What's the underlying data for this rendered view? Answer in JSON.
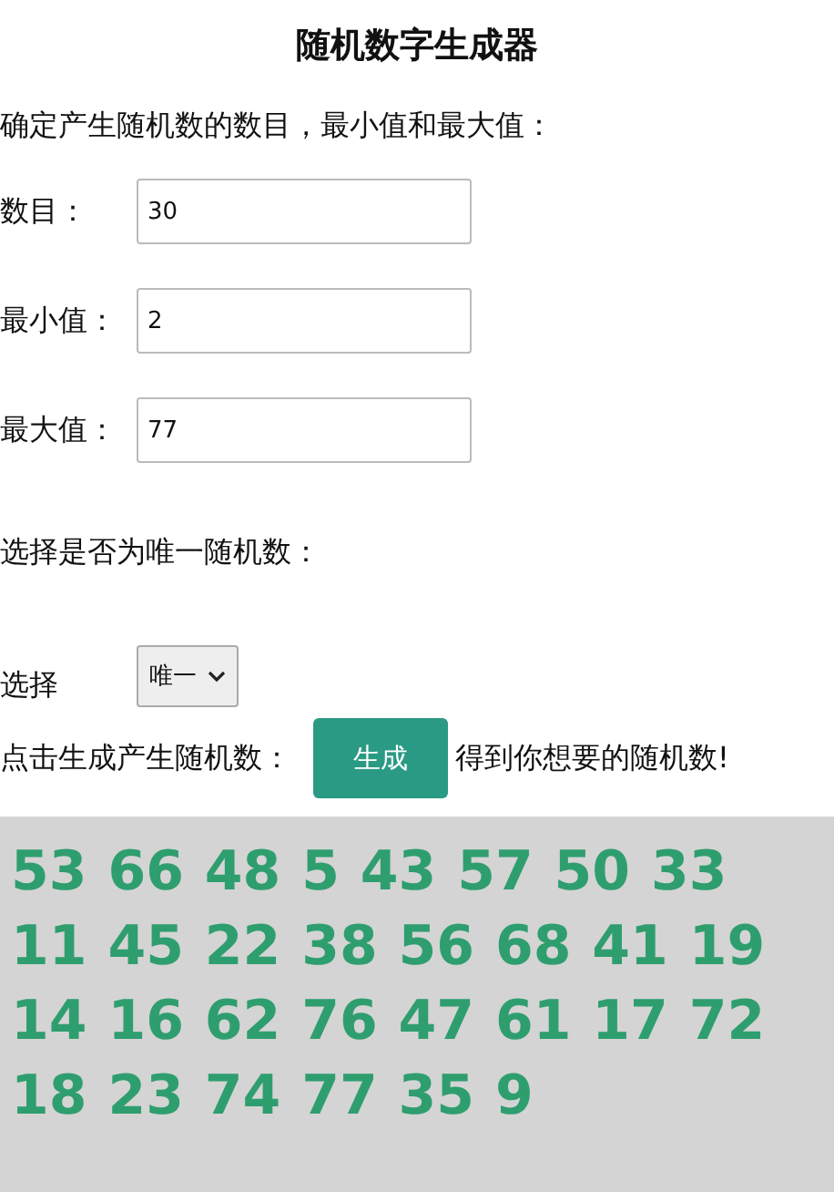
{
  "title": "随机数字生成器",
  "intro": "确定产生随机数的数目，最小值和最大值：",
  "fields": [
    {
      "label": "数目：",
      "value": "30"
    },
    {
      "label": "最小值：",
      "value": "2"
    },
    {
      "label": "最大值：",
      "value": "77"
    }
  ],
  "unique_prompt": "选择是否为唯一随机数：",
  "select": {
    "label": "选择",
    "value": "唯一"
  },
  "generate": {
    "before": "点击生成产生随机数：",
    "button": "生成",
    "after": "得到你想要的随机数!"
  },
  "result": "53 66 48 5 43 57 50 33 11 45 22 38 56 68 41 19 14 16 62 76 47 61 17 72 18 23 74 77 35 9"
}
